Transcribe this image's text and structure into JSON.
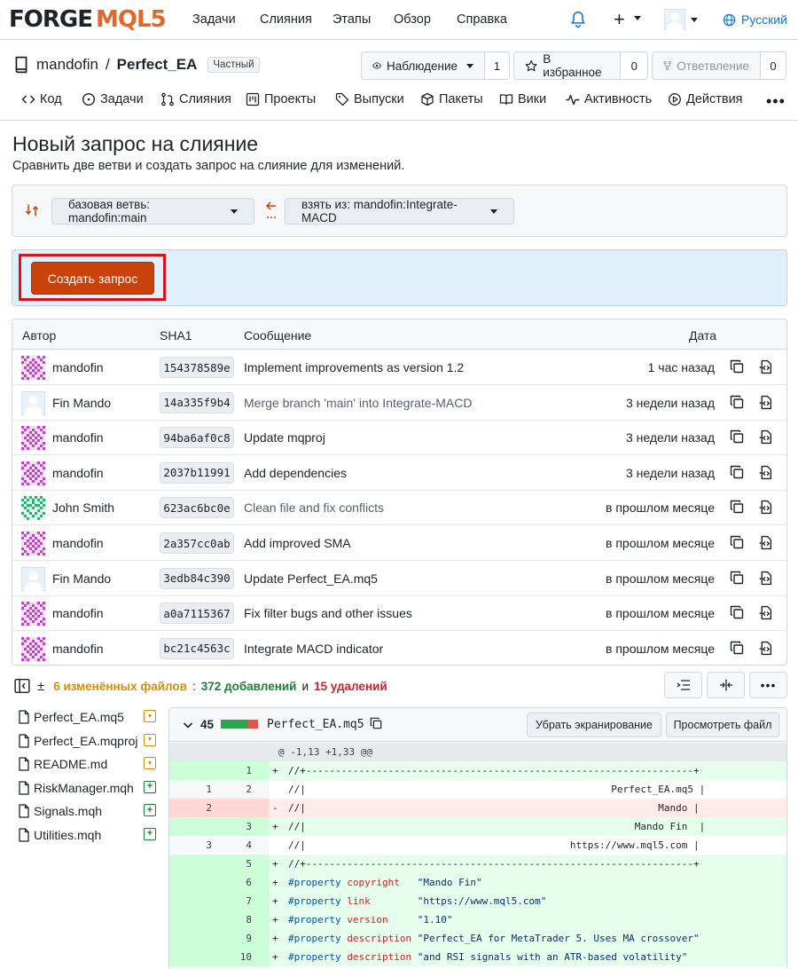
{
  "brand": {
    "forge": "FORGE",
    "mql": "MQL5"
  },
  "topnav": {
    "links": [
      "Задачи",
      "Слияния",
      "Этапы",
      "Обзор",
      "Справка"
    ],
    "language": "Русский"
  },
  "repo": {
    "owner": "mandofin",
    "separator": "/",
    "name": "Perfect_EA",
    "visibility": "Частный",
    "watch": {
      "label": "Наблюдение",
      "count": "1"
    },
    "star": {
      "label": "В избранное",
      "count": "0"
    },
    "fork": {
      "label": "Ответвление",
      "count": "0"
    },
    "tabs": [
      "Код",
      "Задачи",
      "Слияния",
      "Проекты",
      "Выпуски",
      "Пакеты",
      "Вики",
      "Активность",
      "Действия"
    ]
  },
  "page": {
    "title": "Новый запрос на слияние",
    "subtitle": "Сравнить две ветви и создать запрос на слияние для изменений.",
    "base_branch": "базовая ветвь: mandofin:main",
    "compare_branch": "взять из: mandofin:Integrate-MACD",
    "create_button": "Создать запрос"
  },
  "commits": {
    "headers": {
      "author": "Автор",
      "sha": "SHA1",
      "message": "Сообщение",
      "date": "Дата"
    },
    "rows": [
      {
        "author": "mandofin",
        "avatar": "pink",
        "sha": "154378589e",
        "message": "Implement improvements as version 1.2",
        "date": "1 час назад",
        "merge": false
      },
      {
        "author": "Fin Mando",
        "avatar": "default",
        "sha": "14a335f9b4",
        "message": "Merge branch 'main' into Integrate-MACD",
        "date": "3 недели назад",
        "merge": true
      },
      {
        "author": "mandofin",
        "avatar": "pink",
        "sha": "94ba6af0c8",
        "message": "Update mqproj",
        "date": "3 недели назад",
        "merge": false
      },
      {
        "author": "mandofin",
        "avatar": "pink",
        "sha": "2037b11991",
        "message": "Add dependencies",
        "date": "3 недели назад",
        "merge": false
      },
      {
        "author": "John Smith",
        "avatar": "green",
        "sha": "623ac6bc0e",
        "message": "Clean file and fix conflicts",
        "date": "в прошлом месяце",
        "merge": true
      },
      {
        "author": "mandofin",
        "avatar": "pink",
        "sha": "2a357cc0ab",
        "message": "Add improved SMA",
        "date": "в прошлом месяце",
        "merge": false
      },
      {
        "author": "Fin Mando",
        "avatar": "default",
        "sha": "3edb84c390",
        "message": "Update Perfect_EA.mq5",
        "date": "в прошлом месяце",
        "merge": false
      },
      {
        "author": "mandofin",
        "avatar": "pink",
        "sha": "a0a7115367",
        "message": "Fix filter bugs and other issues",
        "date": "в прошлом месяце",
        "merge": false
      },
      {
        "author": "mandofin",
        "avatar": "pink",
        "sha": "bc21c4563c",
        "message": "Integrate MACD indicator",
        "date": "в прошлом месяце",
        "merge": false
      }
    ]
  },
  "diffstat": {
    "files": "6 изменённых файлов",
    "sep": ":",
    "additions": "372 добавлений",
    "and": "и",
    "deletions": "15 удалений"
  },
  "files": [
    {
      "name": "Perfect_EA.mq5",
      "status": "modified",
      "status_glyph": "•"
    },
    {
      "name": "Perfect_EA.mqproj",
      "status": "modified",
      "status_glyph": "•"
    },
    {
      "name": "README.md",
      "status": "modified",
      "status_glyph": "•"
    },
    {
      "name": "RiskManager.mqh",
      "status": "added",
      "status_glyph": "+"
    },
    {
      "name": "Signals.mqh",
      "status": "added",
      "status_glyph": "+"
    },
    {
      "name": "Utilities.mqh",
      "status": "added",
      "status_glyph": "+"
    }
  ],
  "diff": {
    "changes": "45",
    "filename": "Perfect_EA.mq5",
    "unescape_button": "Убрать экранирование",
    "view_file_button": "Просмотреть файл",
    "hunk": "@ -1,13 +1,33 @@",
    "lines": [
      {
        "type": "add",
        "old": "",
        "new": "1",
        "sign": "+",
        "text": "//+------------------------------------------------------------------+"
      },
      {
        "type": "ctx",
        "old": "1",
        "new": "2",
        "sign": "",
        "text": "//|                                                    Perfect_EA.mq5 |"
      },
      {
        "type": "del",
        "old": "2",
        "new": "",
        "sign": "-",
        "text": "//|                                                            Mando |"
      },
      {
        "type": "add",
        "old": "",
        "new": "3",
        "sign": "+",
        "text": "//|                                                        Mando Fin  |"
      },
      {
        "type": "ctx",
        "old": "3",
        "new": "4",
        "sign": "",
        "text": "//|                                             https://www.mql5.com |"
      },
      {
        "type": "add",
        "old": "",
        "new": "5",
        "sign": "+",
        "text": "//+------------------------------------------------------------------+"
      },
      {
        "type": "add",
        "old": "",
        "new": "6",
        "sign": "+",
        "kw": "#property",
        "prop": "copyright",
        "val": "\"Mando Fin\""
      },
      {
        "type": "add",
        "old": "",
        "new": "7",
        "sign": "+",
        "kw": "#property",
        "prop": "link",
        "val": "\"https://www.mql5.com\""
      },
      {
        "type": "add",
        "old": "",
        "new": "8",
        "sign": "+",
        "kw": "#property",
        "prop": "version",
        "val": "\"1.10\""
      },
      {
        "type": "add",
        "old": "",
        "new": "9",
        "sign": "+",
        "kw": "#property",
        "prop": "description",
        "val": "\"Perfect_EA for MetaTrader 5. Uses MA crossover\""
      },
      {
        "type": "add",
        "old": "",
        "new": "10",
        "sign": "+",
        "kw": "#property",
        "prop": "description",
        "val": "\"and RSI signals with an ATR-based volatility\""
      }
    ]
  },
  "colors": {
    "accent": "#c9410b",
    "link": "#1a6fd9",
    "added": "#1a7f37",
    "deleted": "#cf222e",
    "modified": "#d58d05"
  }
}
